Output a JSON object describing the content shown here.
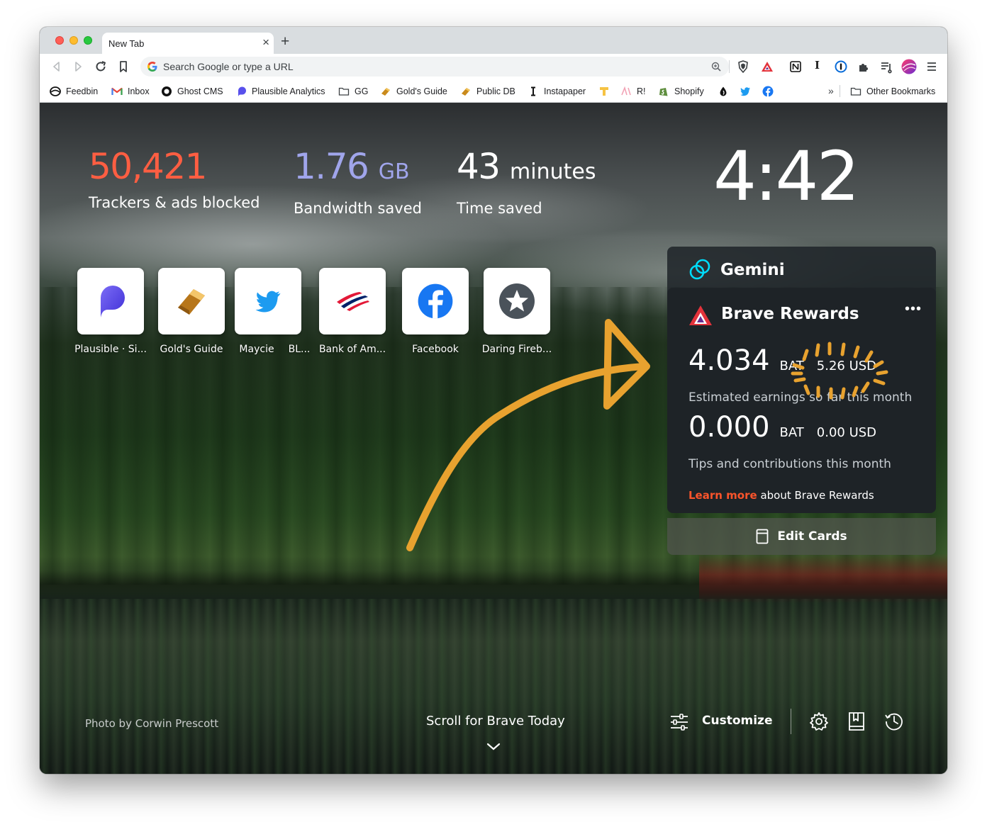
{
  "browser": {
    "tab_title": "New Tab",
    "tab_close": "×",
    "new_tab": "+",
    "omnibox_placeholder": "Search Google or type a URL"
  },
  "bookmarks": [
    {
      "label": "Feedbin",
      "icon": "feedbin-icon"
    },
    {
      "label": "Inbox",
      "icon": "gmail-icon"
    },
    {
      "label": "Ghost CMS",
      "icon": "ghost-icon"
    },
    {
      "label": "Plausible Analytics",
      "icon": "plausible-icon"
    },
    {
      "label": "GG",
      "icon": "folder-icon"
    },
    {
      "label": "Gold's Guide",
      "icon": "gold-bar-icon"
    },
    {
      "label": "Public DB",
      "icon": "gold-bar-icon"
    },
    {
      "label": "Instapaper",
      "icon": "instapaper-icon"
    },
    {
      "label": "",
      "icon": "t-letter-icon"
    },
    {
      "label": "R!",
      "icon": "r-icon"
    },
    {
      "label": "Shopify",
      "icon": "shopify-icon"
    },
    {
      "label": "",
      "icon": "droplet-icon"
    },
    {
      "label": "",
      "icon": "twitter-icon"
    },
    {
      "label": "",
      "icon": "facebook-icon"
    }
  ],
  "bookmarks_overflow": "»",
  "other_bookmarks": "Other Bookmarks",
  "stats": {
    "trackers": {
      "value": "50,421",
      "label": "Trackers & ads blocked"
    },
    "bandwidth": {
      "value": "1.76",
      "unit": "GB",
      "label": "Bandwidth saved"
    },
    "time": {
      "value": "43",
      "unit": "minutes",
      "label": "Time saved"
    }
  },
  "clock": "4:42",
  "top_sites": [
    {
      "name": "Plausible · Si...",
      "icon": "plausible-icon"
    },
    {
      "name": "Gold's Guide",
      "icon": "gold-bar-icon"
    },
    {
      "name": "Maycie",
      "icon": "twitter-icon"
    },
    {
      "name": "BL...",
      "icon": ""
    },
    {
      "name": "Bank of Am...",
      "icon": "bank-of-america-icon"
    },
    {
      "name": "Facebook",
      "icon": "facebook-icon"
    },
    {
      "name": "Daring Fireb...",
      "icon": "star-icon"
    }
  ],
  "gemini": {
    "title": "Gemini"
  },
  "rewards": {
    "title": "Brave Rewards",
    "more": "•••",
    "earnings": {
      "amount": "4.034",
      "unit": "BAT",
      "usd": "5.26 USD",
      "desc": "Estimated earnings so far this month"
    },
    "tips": {
      "amount": "0.000",
      "unit": "BAT",
      "usd": "0.00 USD",
      "desc": "Tips and contributions this month"
    },
    "learn_link": "Learn more",
    "learn_rest": " about Brave Rewards"
  },
  "edit_cards": "Edit Cards",
  "footer": {
    "photo_credit": "Photo by Corwin Prescott",
    "scroll": "Scroll for Brave Today",
    "customize": "Customize"
  },
  "colors": {
    "tracker_accent": "#ff5e42",
    "bandwidth_accent": "#a0a5eb",
    "link_accent": "#fb542b",
    "annotation": "#e8a22f"
  }
}
